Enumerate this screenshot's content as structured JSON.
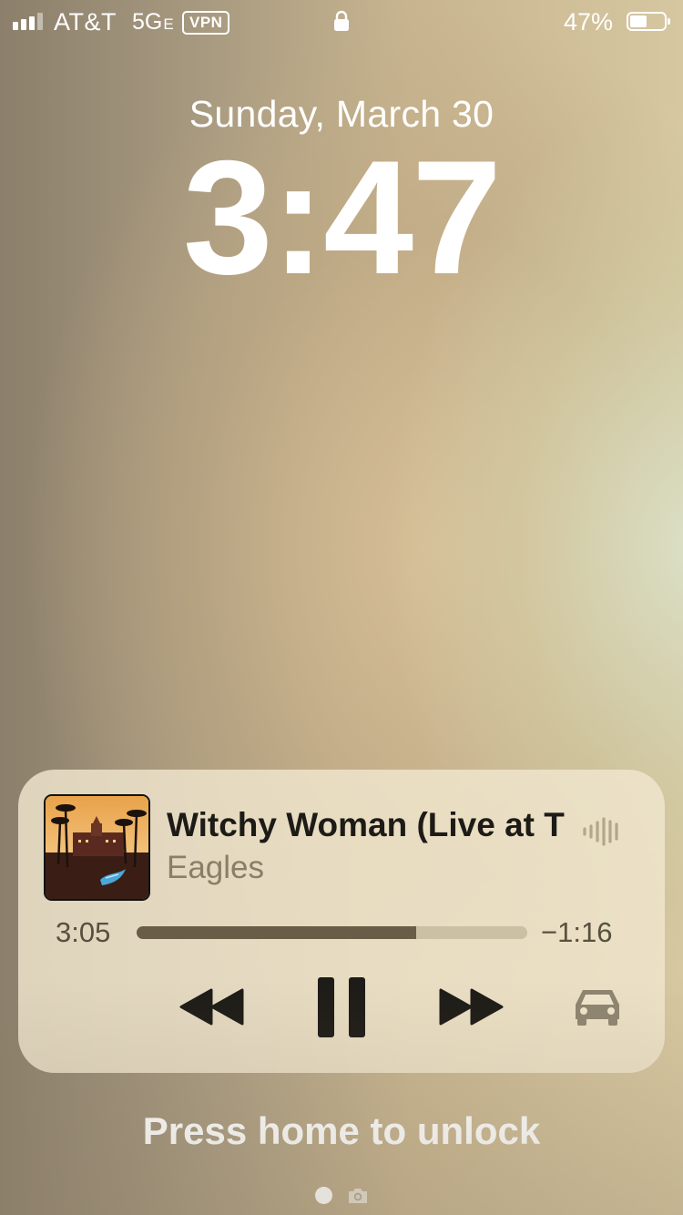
{
  "status_bar": {
    "carrier": "AT&T",
    "network": "5G",
    "network_suffix": "E",
    "vpn": "VPN",
    "battery_percent": "47%",
    "battery_level": 0.47,
    "signal_bars_active": 3,
    "signal_bars_total": 4,
    "icons": [
      "signal-icon",
      "lock-icon",
      "battery-icon"
    ]
  },
  "lock_screen": {
    "date": "Sunday, March 30",
    "time": "3:47",
    "unlock_hint": "Press home to unlock"
  },
  "now_playing": {
    "title": "Witchy Woman (Live at T",
    "artist": "Eagles",
    "elapsed": "3:05",
    "remaining": "−1:16",
    "progress": 0.715,
    "controls": [
      "rewind-icon",
      "pause-icon",
      "fast-forward-icon",
      "car-icon"
    ],
    "colors": {
      "panel": "#f0e6ce",
      "progress_fill": "#6a5d47",
      "progress_track": "#cbbfa4"
    }
  },
  "page_indicator": {
    "pages": 2,
    "active": 0,
    "secondary_icon": "camera-icon"
  }
}
